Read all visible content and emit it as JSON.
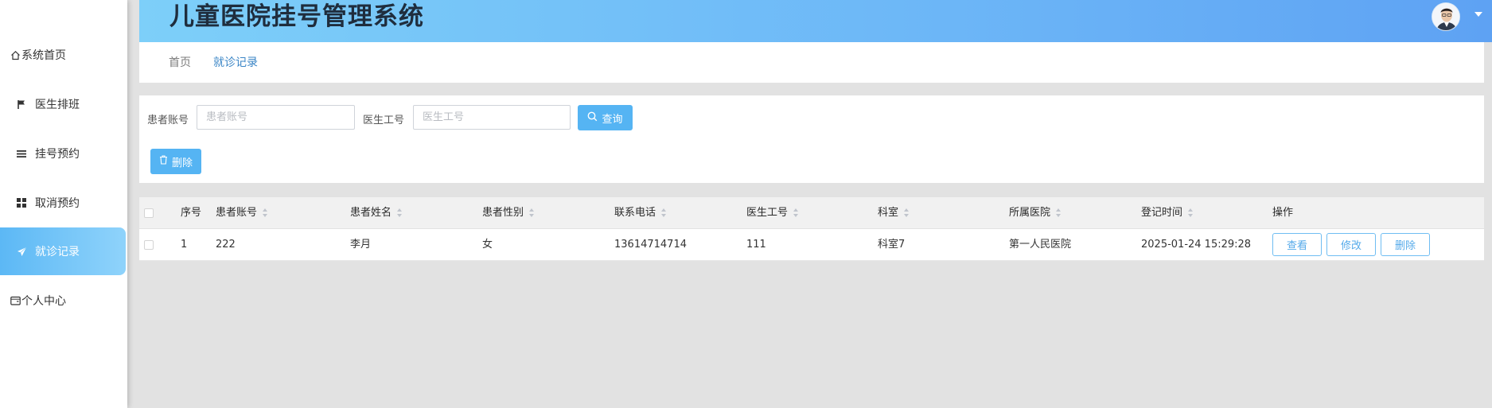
{
  "app": {
    "title": "儿童医院挂号管理系统"
  },
  "sidebar": {
    "items": [
      {
        "label": "系统首页",
        "icon": "home-icon"
      },
      {
        "label": "医生排班",
        "icon": "flag-icon"
      },
      {
        "label": "挂号预约",
        "icon": "list-icon"
      },
      {
        "label": "取消预约",
        "icon": "grid-icon"
      },
      {
        "label": "就诊记录",
        "icon": "send-icon",
        "active": true
      },
      {
        "label": "个人中心",
        "icon": "wallet-icon"
      }
    ]
  },
  "breadcrumb": {
    "home": "首页",
    "current": "就诊记录"
  },
  "filters": {
    "patient_account": {
      "label": "患者账号",
      "placeholder": "患者账号",
      "value": ""
    },
    "doctor_id": {
      "label": "医生工号",
      "placeholder": "医生工号",
      "value": ""
    },
    "search_label": "查询",
    "delete_label": "删除"
  },
  "table": {
    "columns": [
      "序号",
      "患者账号",
      "患者姓名",
      "患者性别",
      "联系电话",
      "医生工号",
      "科室",
      "所属医院",
      "登记时间",
      "操作"
    ],
    "rows": [
      {
        "index": "1",
        "patient_account": "222",
        "patient_name": "李月",
        "gender": "女",
        "phone": "13614714714",
        "doctor_id": "111",
        "department": "科室7",
        "hospital": "第一人民医院",
        "registered_at": "2025-01-24 15:29:28"
      }
    ],
    "actions": {
      "view": "查看",
      "edit": "修改",
      "delete": "删除"
    }
  },
  "colors": {
    "accent": "#55b4f3",
    "header_start": "#7dcff9",
    "header_end": "#5ea2f3"
  }
}
